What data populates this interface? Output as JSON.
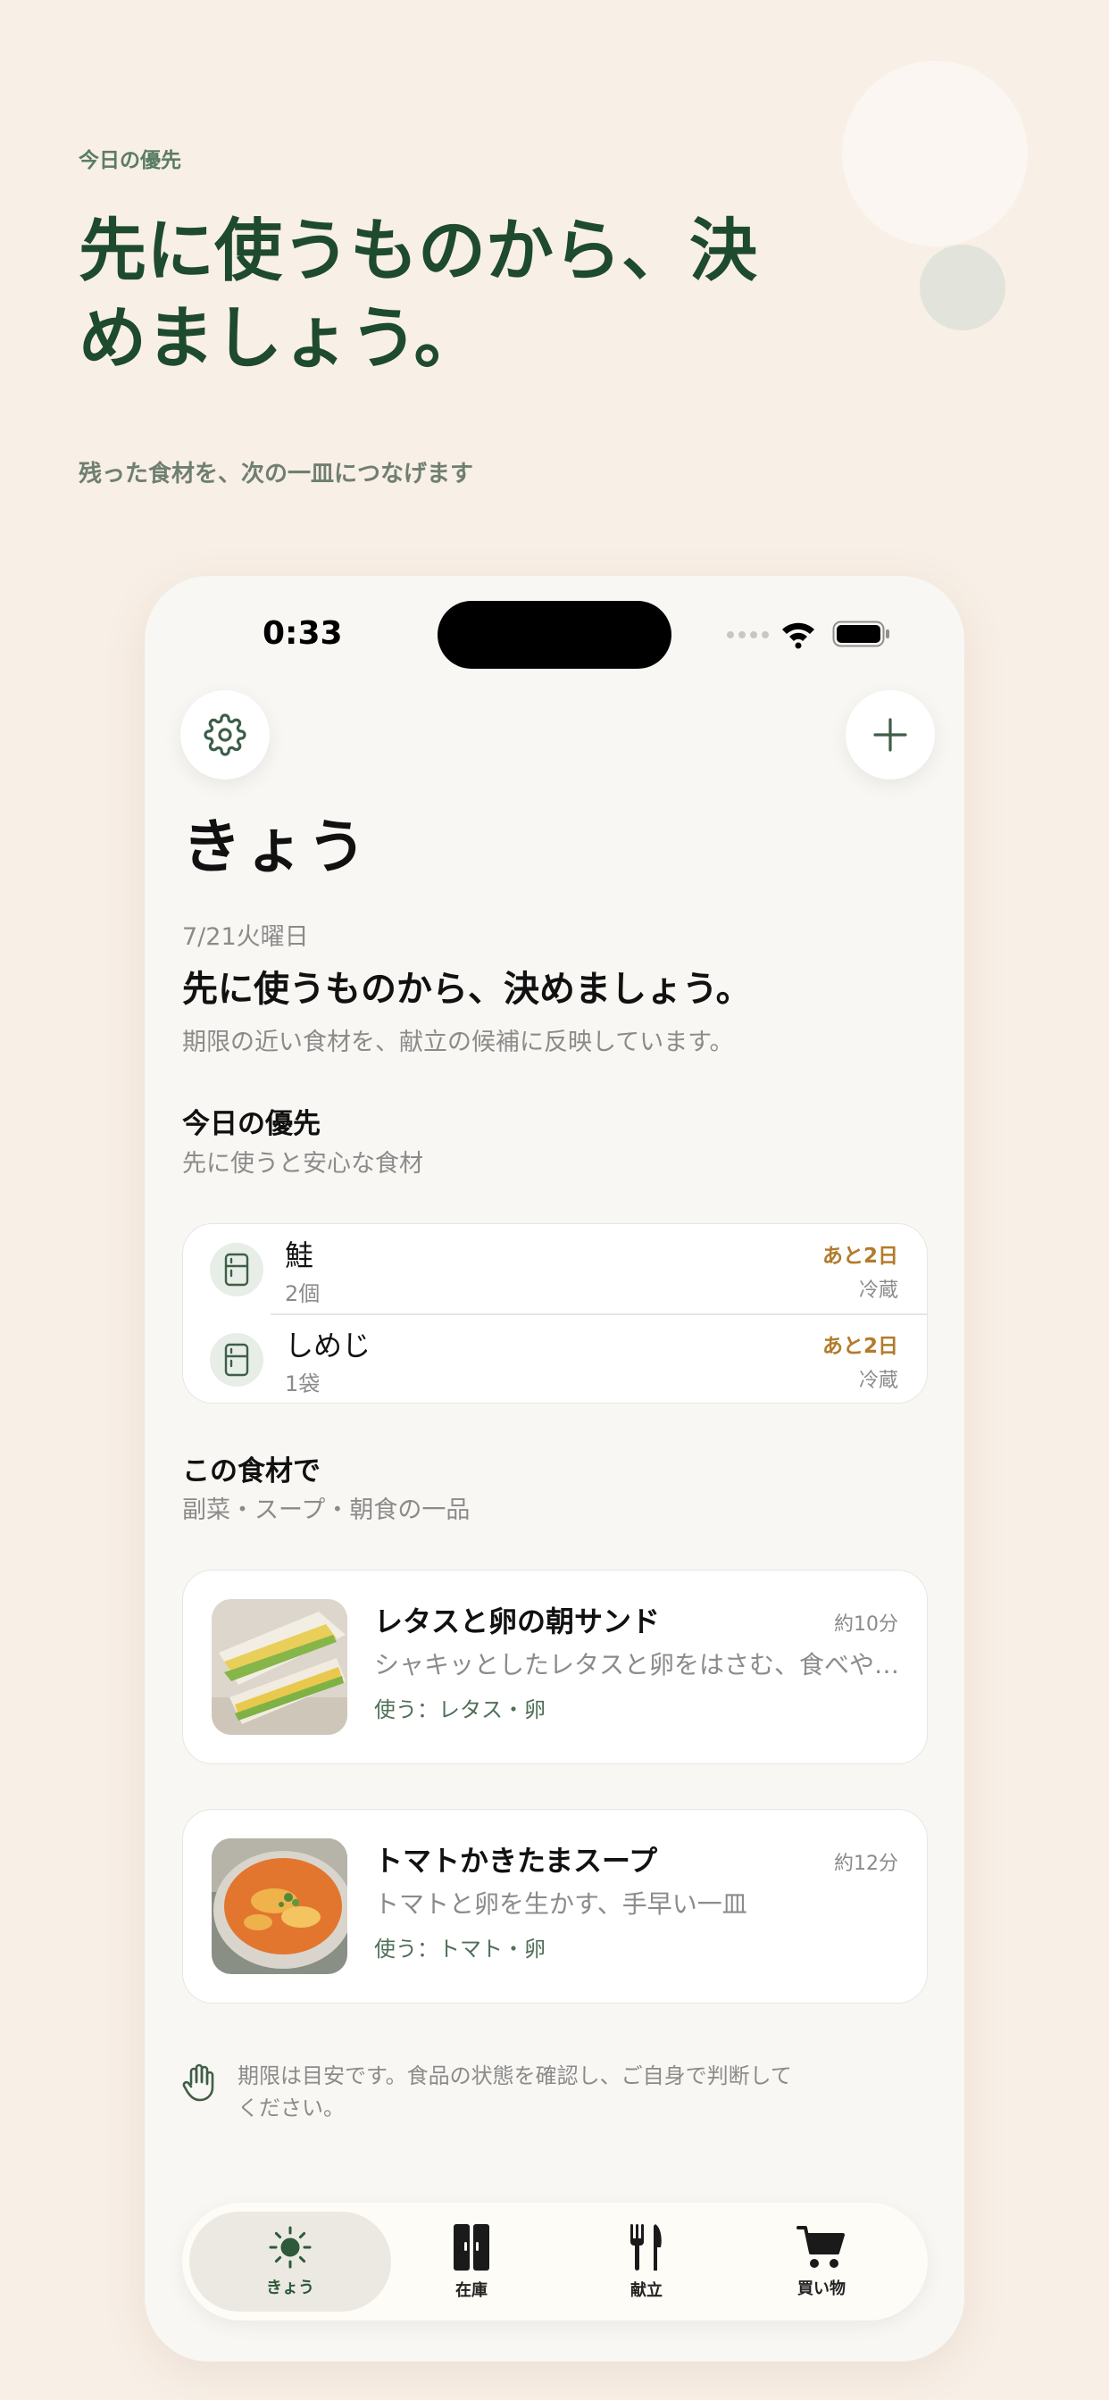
{
  "hero": {
    "eyebrow": "今日の優先",
    "title": "先に使うものから、決めましょう。",
    "subtitle": "残った食材を、次の一皿につなげます"
  },
  "status_bar": {
    "time": "0:33"
  },
  "header": {
    "title": "きょう"
  },
  "summary": {
    "date": "7/21火曜日",
    "headline": "先に使うものから、決めましょう。",
    "description": "期限の近い食材を、献立の候補に反映しています。"
  },
  "priority": {
    "title": "今日の優先",
    "subtitle": "先に使うと安心な食材",
    "items": [
      {
        "name": "鮭",
        "quantity": "2個",
        "deadline": "あと2日",
        "storage": "冷蔵",
        "icon": "fridge-icon"
      },
      {
        "name": "しめじ",
        "quantity": "1袋",
        "deadline": "あと2日",
        "storage": "冷蔵",
        "icon": "fridge-icon"
      }
    ]
  },
  "suggestions": {
    "title": "この食材で",
    "subtitle": "副菜・スープ・朝食の一品",
    "recipes": [
      {
        "name": "レタスと卵の朝サンド",
        "time": "約10分",
        "description": "シャキッとしたレタスと卵をはさむ、食べやすい一品",
        "uses": "使う：レタス・卵"
      },
      {
        "name": "トマトかきたまスープ",
        "time": "約12分",
        "description": "トマトと卵を生かす、手早い一皿",
        "uses": "使う：トマト・卵"
      }
    ]
  },
  "disclaimer": "期限は目安です。食品の状態を確認し、ご自身で判断してください。",
  "tabs": [
    {
      "label": "きょう",
      "icon": "sun-icon",
      "active": true
    },
    {
      "label": "在庫",
      "icon": "cabinet-icon",
      "active": false
    },
    {
      "label": "献立",
      "icon": "fork-knife-icon",
      "active": false
    },
    {
      "label": "買い物",
      "icon": "cart-icon",
      "active": false
    }
  ],
  "colors": {
    "background": "#f8efe6",
    "brand_green": "#1e4a2e",
    "deadline_amber": "#b27b2c",
    "uses_green": "#4f6f57"
  }
}
